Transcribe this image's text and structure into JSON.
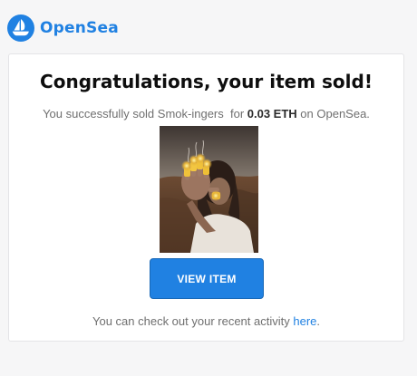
{
  "brand": {
    "name": "OpenSea",
    "logo_icon": "opensea-ship-icon",
    "accent_color": "#2081e2"
  },
  "email": {
    "title": "Congratulations, your item sold!",
    "message_prefix": "You successfully sold ",
    "item_name": "Smok-ingers",
    "message_for": "  for ",
    "price": "0.03 ETH",
    "message_suffix": " on OpenSea.",
    "image_icon": "nft-photo-image",
    "button_label": "VIEW ITEM",
    "activity_prefix": "You can check out your recent activity ",
    "activity_link": "here",
    "activity_suffix": "."
  }
}
